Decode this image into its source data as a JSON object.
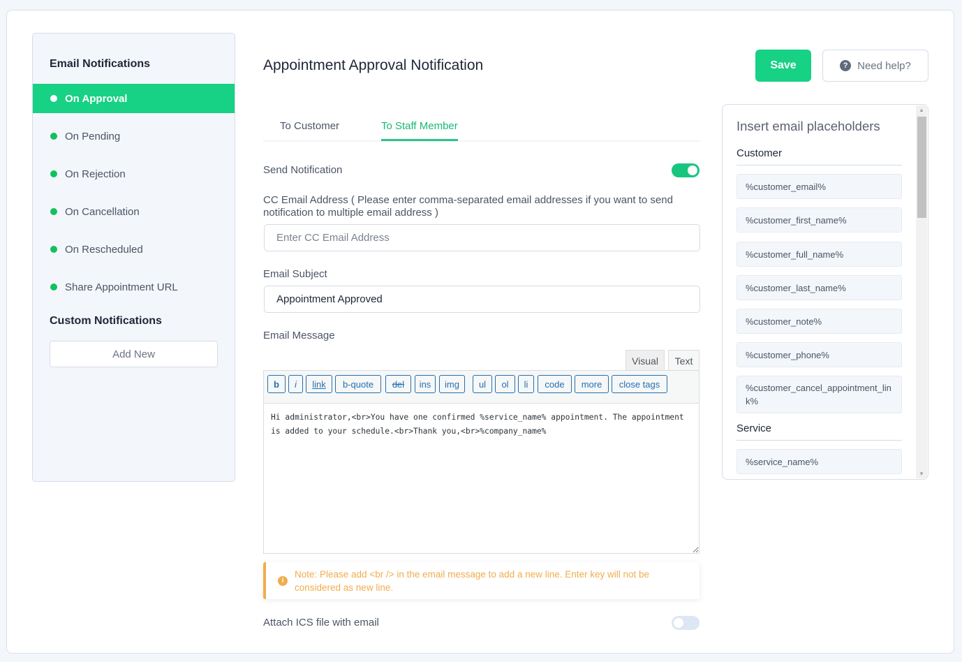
{
  "sidebar": {
    "email_heading": "Email Notifications",
    "items": [
      {
        "label": "On Approval",
        "active": true
      },
      {
        "label": "On Pending",
        "active": false
      },
      {
        "label": "On Rejection",
        "active": false
      },
      {
        "label": "On Cancellation",
        "active": false
      },
      {
        "label": "On Rescheduled",
        "active": false
      },
      {
        "label": "Share Appointment URL",
        "active": false
      }
    ],
    "custom_heading": "Custom Notifications",
    "add_new_label": "Add New"
  },
  "header": {
    "title": "Appointment Approval Notification",
    "save_label": "Save",
    "help_label": "Need help?",
    "help_icon": "question-circle-icon"
  },
  "tabs": [
    {
      "label": "To Customer",
      "active": false
    },
    {
      "label": "To Staff Member",
      "active": true
    }
  ],
  "form": {
    "send_notification_label": "Send Notification",
    "send_notification_on": true,
    "cc_label": "CC Email Address ( Please enter comma-separated email addresses if you want to send notification to multiple email address )",
    "cc_placeholder": "Enter CC Email Address",
    "cc_value": "",
    "subject_label": "Email Subject",
    "subject_value": "Appointment Approved",
    "message_label": "Email Message",
    "editor_tabs": {
      "visual": "Visual",
      "text": "Text",
      "active": "Text"
    },
    "toolbar_buttons": [
      "b",
      "i",
      "link",
      "b-quote",
      "del",
      "ins",
      "img",
      "ul",
      "ol",
      "li",
      "code",
      "more",
      "close tags"
    ],
    "message_value": "Hi administrator,<br>You have one confirmed %service_name% appointment. The appointment is added to your schedule.<br>Thank you,<br>%company_name%",
    "note_icon": "info-circle-icon",
    "note_text": "Note: Please add <br /> in the email message to add a new line. Enter key will not be considered as new line.",
    "attach_ics_label": "Attach ICS file with email",
    "attach_ics_on": false
  },
  "placeholders": {
    "title": "Insert email placeholders",
    "sections": [
      {
        "name": "Customer",
        "items": [
          "%customer_email%",
          "%customer_first_name%",
          "%customer_full_name%",
          "%customer_last_name%",
          "%customer_note%",
          "%customer_phone%",
          "%customer_cancel_appointment_link%"
        ]
      },
      {
        "name": "Service",
        "items": [
          "%service_name%"
        ]
      }
    ]
  },
  "colors": {
    "accent": "#17d184",
    "link_blue": "#2271b1",
    "warning": "#f0ad4e"
  }
}
